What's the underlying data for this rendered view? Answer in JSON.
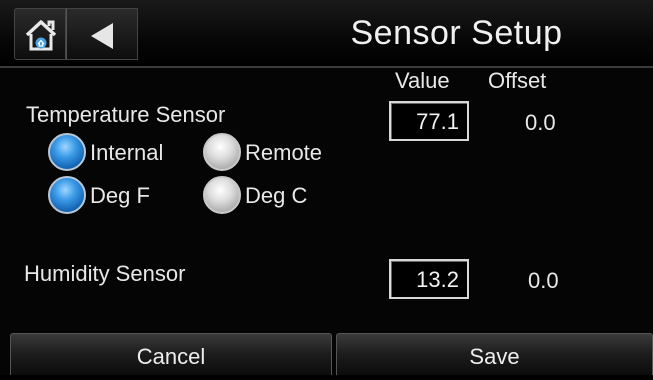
{
  "header": {
    "title": "Sensor Setup",
    "home_icon": "home-icon",
    "back_icon": "back-arrow-icon"
  },
  "columns": {
    "value": "Value",
    "offset": "Offset"
  },
  "temperature": {
    "label": "Temperature Sensor",
    "value": "77.1",
    "offset": "0.0",
    "location_options": [
      {
        "label": "Internal",
        "selected": true
      },
      {
        "label": "Remote",
        "selected": false
      }
    ],
    "unit_options": [
      {
        "label": "Deg F",
        "selected": true
      },
      {
        "label": "Deg C",
        "selected": false
      }
    ]
  },
  "humidity": {
    "label": "Humidity Sensor",
    "value": "13.2",
    "offset": "0.0"
  },
  "footer": {
    "cancel_label": "Cancel",
    "save_label": "Save"
  },
  "colors": {
    "background": "#000000",
    "radio_selected": "#3c9be8",
    "home_icon_accent": "#4aa3e0"
  }
}
